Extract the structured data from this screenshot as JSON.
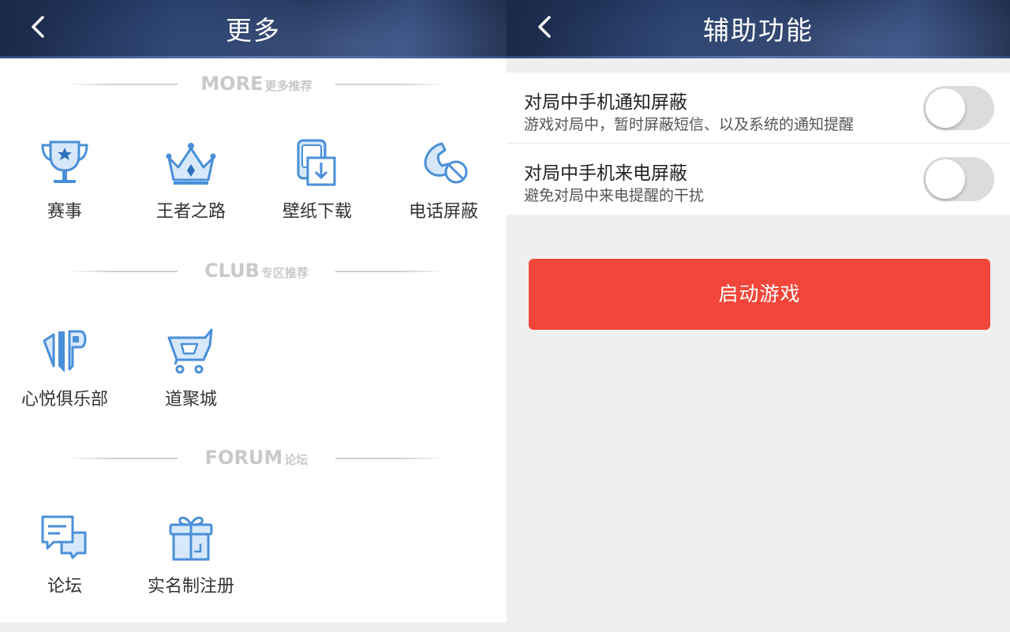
{
  "left": {
    "title": "更多",
    "sections": [
      {
        "en": "MORE",
        "zh": "更多推荐",
        "items": [
          {
            "label": "赛事",
            "icon": "trophy-icon"
          },
          {
            "label": "王者之路",
            "icon": "crown-icon"
          },
          {
            "label": "壁纸下载",
            "icon": "wallpaper-download-icon"
          },
          {
            "label": "电话屏蔽",
            "icon": "phone-block-icon"
          }
        ]
      },
      {
        "en": "CLUB",
        "zh": "专区推荐",
        "items": [
          {
            "label": "心悦俱乐部",
            "icon": "vip-icon"
          },
          {
            "label": "道聚城",
            "icon": "shopping-cart-icon"
          }
        ]
      },
      {
        "en": "FORUM",
        "zh": "论坛",
        "items": [
          {
            "label": "论坛",
            "icon": "chat-bubbles-icon"
          },
          {
            "label": "实名制注册",
            "icon": "gift-box-icon"
          }
        ]
      }
    ]
  },
  "right": {
    "title": "辅助功能",
    "settings": [
      {
        "title": "对局中手机通知屏蔽",
        "desc": "游戏对局中，暂时屏蔽短信、以及系统的通知提醒",
        "enabled": false
      },
      {
        "title": "对局中手机来电屏蔽",
        "desc": "避免对局中来电提醒的干扰",
        "enabled": false
      }
    ],
    "launch_label": "启动游戏"
  },
  "colors": {
    "accent_icon": "#4a8fd9",
    "launch_button": "#f2463a",
    "toggle_off": "#dcdcdc"
  }
}
